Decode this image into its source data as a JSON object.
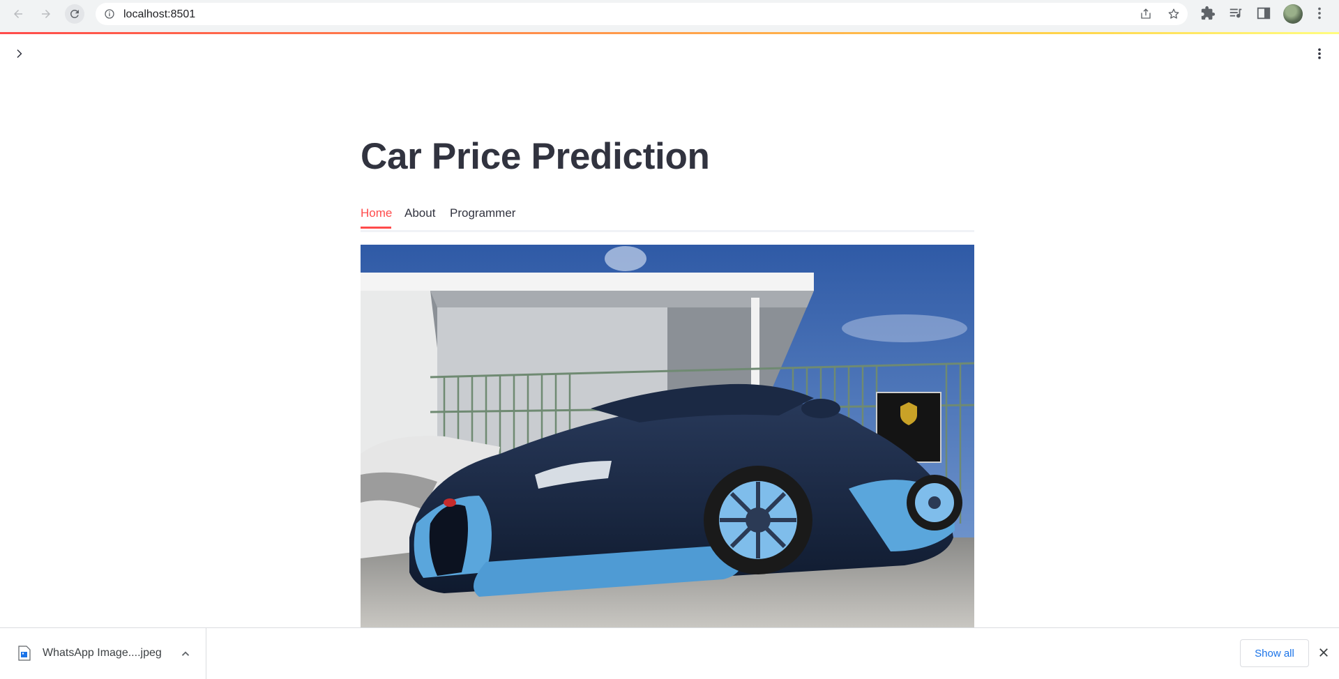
{
  "browser": {
    "url": "localhost:8501",
    "colors": {
      "chrome_bg": "#f1f3f4",
      "accent": "#ff4b4b"
    }
  },
  "app": {
    "title": "Car Price Prediction",
    "tabs": [
      {
        "label": "Home",
        "active": true
      },
      {
        "label": "About",
        "active": false
      },
      {
        "label": "Programmer",
        "active": false
      }
    ],
    "hero_image": "blue-sports-car-photo"
  },
  "downloads": {
    "file_name": "WhatsApp Image....jpeg",
    "show_all_label": "Show all"
  }
}
